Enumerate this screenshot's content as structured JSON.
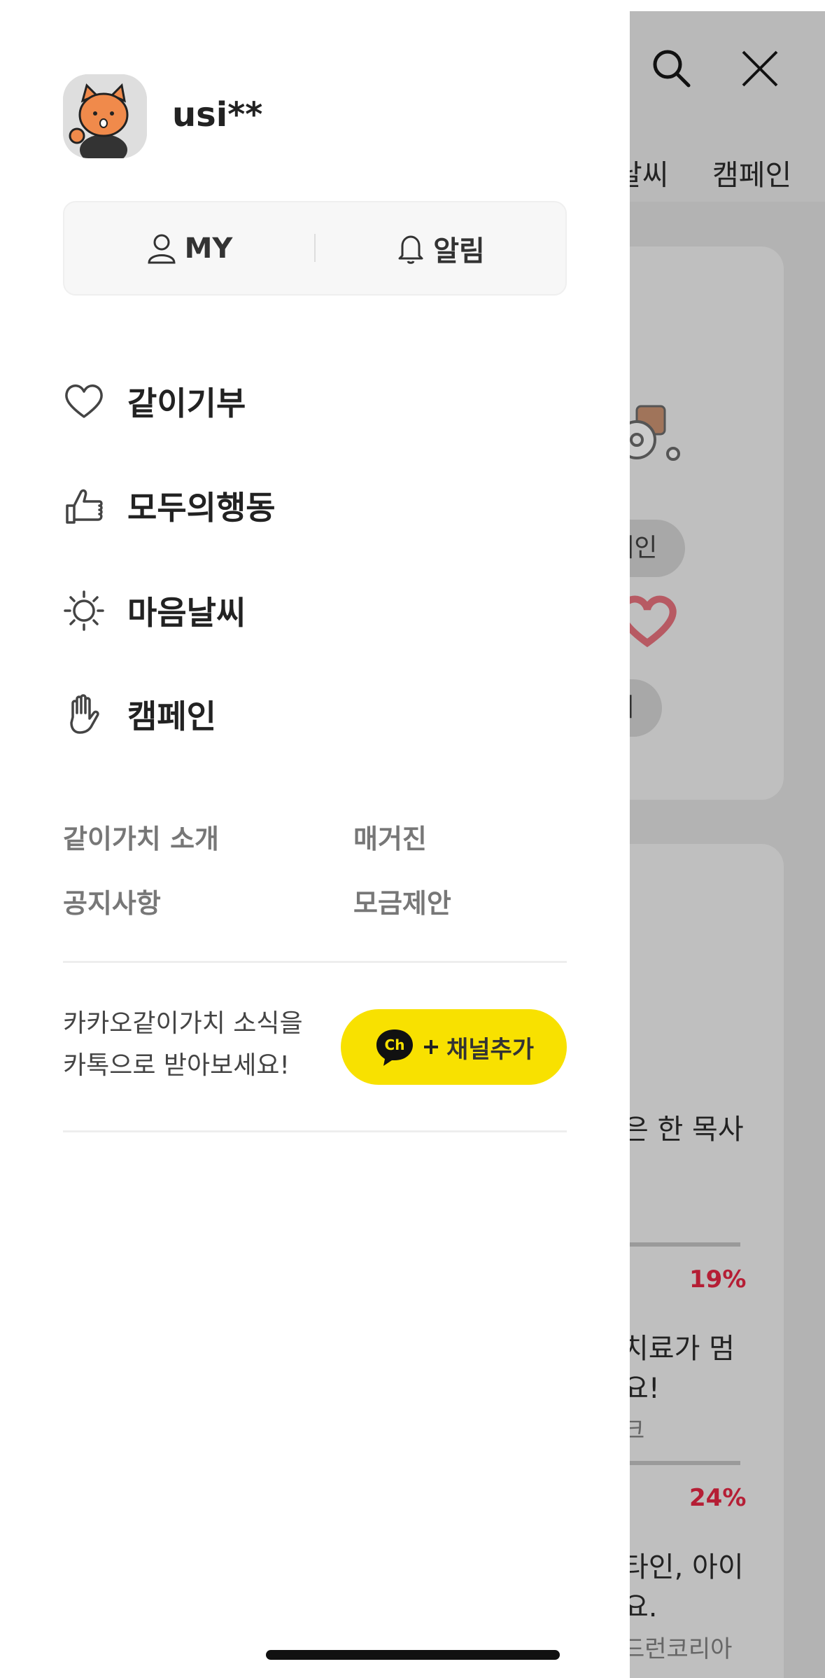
{
  "background": {
    "nav": [
      "날씨",
      "캠페인"
    ],
    "chips": [
      "장애인",
      "전체"
    ],
    "texts": [
      "은 한 목사",
      "치료가 멈",
      "요!",
      "타인, 아이",
      "요."
    ],
    "subs": [
      "크",
      "드런코리아"
    ],
    "percents": [
      "19%",
      "24%"
    ]
  },
  "drawer": {
    "username": "usi**",
    "tabs": [
      {
        "label": "MY",
        "icon": "person-icon"
      },
      {
        "label": "알림",
        "icon": "bell-icon"
      }
    ],
    "menu": [
      {
        "label": "같이기부",
        "icon": "heart-icon"
      },
      {
        "label": "모두의행동",
        "icon": "thumbs-up-icon"
      },
      {
        "label": "마음날씨",
        "icon": "sun-icon"
      },
      {
        "label": "캠페인",
        "icon": "hand-icon"
      }
    ],
    "links": [
      "같이가치 소개",
      "매거진",
      "공지사항",
      "모금제안"
    ],
    "promo_line1": "카카오같이가치 소식을",
    "promo_line2": "카톡으로 받아보세요!",
    "channel_button": "채널추가",
    "channel_badge": "Ch"
  },
  "colors": {
    "accent_yellow": "#F8E100",
    "percent_red": "#B51E35",
    "overlay_gray": "#B3B3B3"
  }
}
